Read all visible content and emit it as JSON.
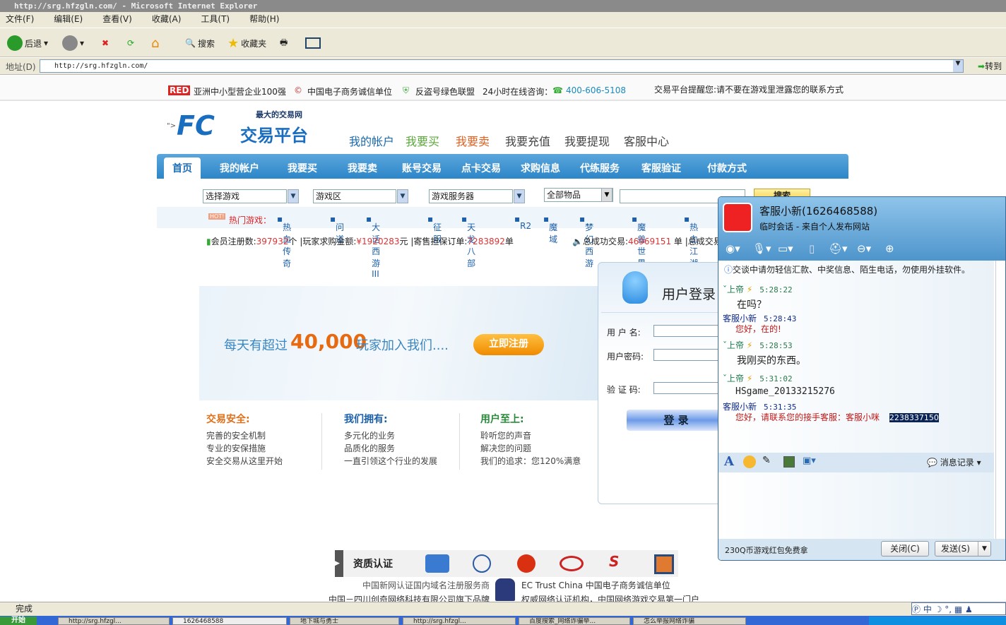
{
  "window": {
    "title": "http://srg.hfzgln.com/ - Microsoft Internet Explorer"
  },
  "menu": [
    "文件(F)",
    "编辑(E)",
    "查看(V)",
    "收藏(A)",
    "工具(T)",
    "帮助(H)"
  ],
  "toolbar": {
    "back": "后退",
    "search": "搜索",
    "favorites": "收藏夹"
  },
  "address": {
    "label": "地址(D)",
    "url": "http://srg.hfzgln.com/",
    "go": "转到"
  },
  "topstrip": {
    "red": "RED",
    "award": "亚洲中小型营企业100强",
    "trust": "中国电子商务诚信单位",
    "anti": "反盗号绿色联盟",
    "hotline_label": "24小时在线咨询：",
    "hotline": "400-606-5108",
    "notice": "交易平台提醒您:请不要在游戏里泄露您的联系方式"
  },
  "logo": {
    "slogan": "最大的交易网",
    "name": "交易平台",
    "prefix": "\">"
  },
  "nav1": [
    "我的帐户",
    "我要买",
    "我要卖",
    "我要充值",
    "我要提现",
    "客服中心"
  ],
  "nav2": [
    "首页",
    "我的帐户",
    "我要买",
    "我要卖",
    "账号交易",
    "点卡交易",
    "求购信息",
    "代练服务",
    "客服验证",
    "付款方式"
  ],
  "search": {
    "game": "选择游戏",
    "zone": "游戏区",
    "server": "游戏服务器",
    "item": "全部物品",
    "button": "搜索"
  },
  "hot": {
    "label": "热门游戏：",
    "badge": "HOT!",
    "games": [
      "热血传奇",
      "问道",
      "大话西游III",
      "征服",
      "天龙八部",
      "R2",
      "魔域",
      "梦幻西游",
      "魔兽世界",
      "热血江湖"
    ]
  },
  "stats": {
    "members_label": "会员注册数:",
    "members": "397932",
    "members_unit": "个",
    "buy_label": "|玩家求购金额:",
    "buy": "¥1920283",
    "buy_unit": "元",
    "orders_label": "|寄售担保订单:",
    "orders": "7283892",
    "orders_unit": "单",
    "total_label": "总成功交易:",
    "total": "46969151",
    "total_unit": "单",
    "total2": "|总成交易"
  },
  "banner": {
    "pre": "每天有超过",
    "num": "40,000",
    "post": "玩家加入我们....",
    "register": "立即注册"
  },
  "features": [
    {
      "title": "交易安全:",
      "items": [
        "完善的安全机制",
        "专业的安保措施",
        "安全交易从这里开始"
      ]
    },
    {
      "title": "我们拥有:",
      "items": [
        "多元化的业务",
        "品质化的服务",
        "一直引领这个行业的发展"
      ]
    },
    {
      "title": "用户至上:",
      "items": [
        "聆听您的声音",
        "解决您的问题",
        "我们的追求：您120%满意"
      ]
    }
  ],
  "login": {
    "title": "用户登录",
    "username": "用 户 名:",
    "password": "用户密码:",
    "captcha": "验 证 码:",
    "submit": "登  录"
  },
  "certs": {
    "title": "资质认证",
    "line1a": "中国新网认证国内域名注册服务商",
    "line1b": "EC Trust China 中国电子商务诚信单位",
    "line2a": "中国－四川创奇网络科技有限公司旗下品牌",
    "line2b": "权威网络认证机构，中国网络游戏交易第一门户"
  },
  "qq": {
    "name": "客服小新(1626468588)",
    "subtitle": "临时会话 - 来自个人发布网站",
    "warning": "交谈中请勿轻信汇款、中奖信息、陌生电话，勿使用外挂软件。",
    "messages": [
      {
        "sender": "ˇ上帝",
        "time": "5:28:22",
        "text": "在吗？",
        "self": true
      },
      {
        "sender": "客服小新",
        "time": "5:28:43",
        "text": "您好，在的!",
        "self": false
      },
      {
        "sender": "ˇ上帝",
        "time": "5:28:53",
        "text": "我刚买的东西。",
        "self": true
      },
      {
        "sender": "ˇ上帝",
        "time": "5:31:02",
        "text": "HSgame_20133215276",
        "self": true
      },
      {
        "sender": "客服小新",
        "time": "5:31:35",
        "text": "您好，请联系您的接手客服：客服小咪",
        "highlight": "2238337150",
        "self": false
      }
    ],
    "history": "消息记录",
    "promo": "230Q币游戏红包免费拿",
    "close": "关闭(C)",
    "send": "发送(S)"
  },
  "status": {
    "text": "完成"
  },
  "taskbar": {
    "start": "开始",
    "items": [
      "http://srg.hfzgl...",
      "1626468588",
      "地下城与勇士",
      "http://srg.hfzgl...",
      "百度搜索_网络诈骗举...",
      "怎么举报网络诈骗"
    ],
    "ime": "中"
  }
}
